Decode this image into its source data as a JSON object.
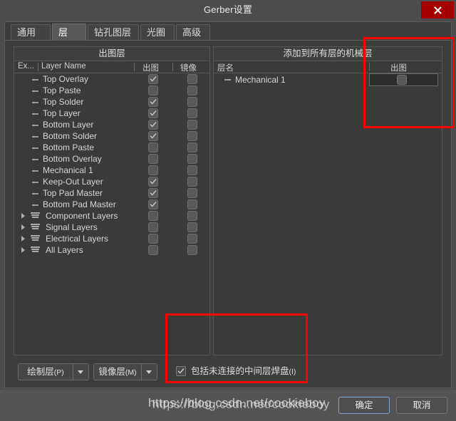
{
  "window": {
    "title": "Gerber设置",
    "close_label": "✕"
  },
  "tabs": [
    {
      "label": "通用",
      "active": false
    },
    {
      "label": "层",
      "active": true
    },
    {
      "label": "钻孔图层",
      "active": false
    },
    {
      "label": "光圈",
      "active": false
    },
    {
      "label": "高级",
      "active": false
    }
  ],
  "left_panel": {
    "title": "出图层",
    "columns": {
      "extend": "Ex...",
      "layer_name": "Layer Name",
      "print": "出图",
      "mirror": "镜像"
    },
    "rows": [
      {
        "name": "Top Overlay",
        "type": "layer",
        "print": true,
        "mirror": false
      },
      {
        "name": "Top Paste",
        "type": "layer",
        "print": false,
        "mirror": false
      },
      {
        "name": "Top Solder",
        "type": "layer",
        "print": true,
        "mirror": false
      },
      {
        "name": "Top Layer",
        "type": "layer",
        "print": true,
        "mirror": false
      },
      {
        "name": "Bottom Layer",
        "type": "layer",
        "print": true,
        "mirror": false
      },
      {
        "name": "Bottom Solder",
        "type": "layer",
        "print": true,
        "mirror": false
      },
      {
        "name": "Bottom Paste",
        "type": "layer",
        "print": false,
        "mirror": false
      },
      {
        "name": "Bottom Overlay",
        "type": "layer",
        "print": false,
        "mirror": false
      },
      {
        "name": "Mechanical 1",
        "type": "layer",
        "print": false,
        "mirror": false
      },
      {
        "name": "Keep-Out Layer",
        "type": "layer",
        "print": true,
        "mirror": false
      },
      {
        "name": "Top Pad Master",
        "type": "layer",
        "print": true,
        "mirror": false
      },
      {
        "name": "Bottom Pad Master",
        "type": "layer",
        "print": true,
        "mirror": false
      },
      {
        "name": "Component Layers",
        "type": "group",
        "print": false,
        "mirror": false
      },
      {
        "name": "Signal Layers",
        "type": "group",
        "print": false,
        "mirror": false
      },
      {
        "name": "Electrical Layers",
        "type": "group",
        "print": false,
        "mirror": false
      },
      {
        "name": "All Layers",
        "type": "group",
        "print": false,
        "mirror": false
      }
    ]
  },
  "right_panel": {
    "title": "添加到所有层的机械层",
    "columns": {
      "layer_name": "层名",
      "print": "出图"
    },
    "rows": [
      {
        "name": "Mechanical 1",
        "print": false
      }
    ]
  },
  "bottom_controls": {
    "draw_layer": {
      "label": "绘制层",
      "accelerator": "(P)"
    },
    "mirror_layer": {
      "label": "镜像层",
      "accelerator": "(M)"
    },
    "include_pads": {
      "label": "包括未连接的中间层焊盘",
      "accelerator": "(I)",
      "checked": true
    }
  },
  "footer": {
    "ok": "确定",
    "cancel": "取消"
  },
  "watermark": {
    "text": "https://blog.csdn.net/cookieboy"
  }
}
